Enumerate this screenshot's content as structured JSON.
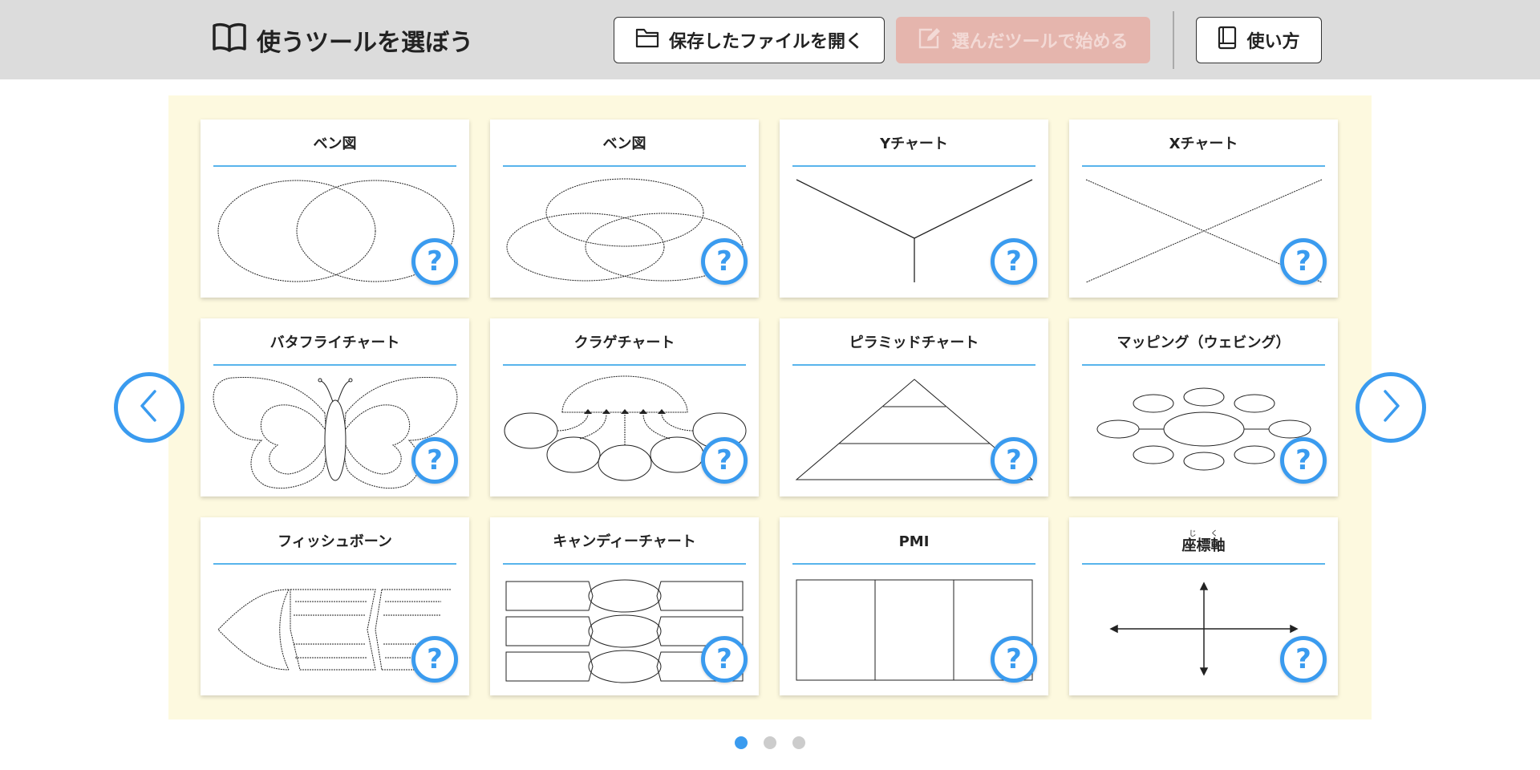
{
  "header": {
    "title": "使うツールを選ぼう",
    "open_file_label": "保存したファイルを開く",
    "start_label": "選んだツールで始める",
    "help_label": "使い方"
  },
  "cards": [
    {
      "title": "ベン図",
      "diagram": "venn-2"
    },
    {
      "title": "ベン図",
      "diagram": "venn-3"
    },
    {
      "title": "Yチャート",
      "diagram": "y-chart"
    },
    {
      "title": "Xチャート",
      "diagram": "x-chart"
    },
    {
      "title": "バタフライチャート",
      "diagram": "butterfly"
    },
    {
      "title": "クラゲチャート",
      "diagram": "jellyfish"
    },
    {
      "title": "ピラミッドチャート",
      "diagram": "pyramid"
    },
    {
      "title": "マッピング（ウェビング）",
      "diagram": "mapping"
    },
    {
      "title": "フィッシュボーン",
      "diagram": "fishbone"
    },
    {
      "title": "キャンディーチャート",
      "diagram": "candy"
    },
    {
      "title": "PMI",
      "diagram": "pmi"
    },
    {
      "title": "座標軸",
      "ruby": "じく",
      "diagram": "axes"
    }
  ],
  "help_icon_glyph": "?",
  "pagination": {
    "pages": 3,
    "current": 1
  },
  "colors": {
    "header_bg": "#dcdcdc",
    "panel_bg": "#fdf9df",
    "accent_blue": "#3a9bef",
    "title_underline": "#58b4ec",
    "disabled_button": "#e5b5ad"
  }
}
